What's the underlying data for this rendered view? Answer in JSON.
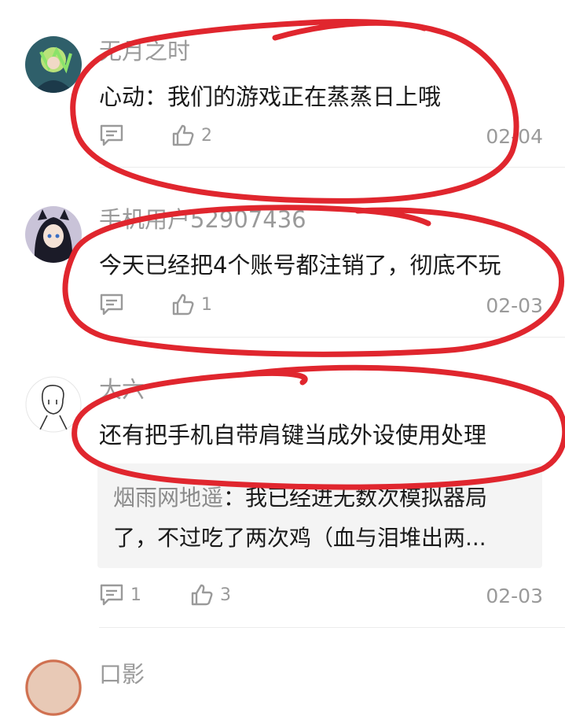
{
  "colors": {
    "annotation": "#e0262e",
    "meta": "#9a9a9a",
    "reply_bg": "#f4f4f4"
  },
  "comments": [
    {
      "username": "无月之时",
      "text": "心动：我们的游戏正在蒸蒸日上哦",
      "reply_icon": "comment-icon",
      "likes": "2",
      "like_icon": "thumbs-up-icon",
      "date": "02-04"
    },
    {
      "username": "手机用户52907436",
      "text": "今天已经把4个账号都注销了，彻底不玩",
      "reply_icon": "comment-icon",
      "likes": "1",
      "like_icon": "thumbs-up-icon",
      "date": "02-03"
    },
    {
      "username": "大六",
      "text": "还有把手机自带肩键当成外设使用处理",
      "reply": {
        "author": "烟雨网地遥",
        "separator": "：",
        "text": "我已经进无数次模拟器局了，不过吃了两次鸡（血与泪堆出两..."
      },
      "replies_count": "1",
      "likes": "3",
      "date": "02-03"
    },
    {
      "username": "口影"
    }
  ]
}
